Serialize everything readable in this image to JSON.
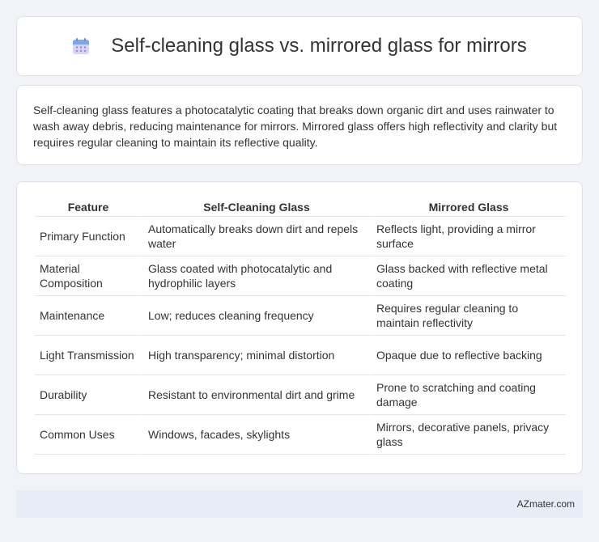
{
  "header": {
    "title": "Self-cleaning glass vs. mirrored glass for mirrors",
    "icon": "calendar-icon"
  },
  "intro": {
    "text": "Self-cleaning glass features a photocatalytic coating that breaks down organic dirt and uses rainwater to wash away debris, reducing maintenance for mirrors. Mirrored glass offers high reflectivity and clarity but requires regular cleaning to maintain its reflective quality."
  },
  "table": {
    "headers": [
      "Feature",
      "Self-Cleaning Glass",
      "Mirrored Glass"
    ],
    "rows": [
      [
        "Primary Function",
        "Automatically breaks down dirt and repels water",
        "Reflects light, providing a mirror surface"
      ],
      [
        "Material Composition",
        "Glass coated with photocatalytic and hydrophilic layers",
        "Glass backed with reflective metal coating"
      ],
      [
        "Maintenance",
        "Low; reduces cleaning frequency",
        "Requires regular cleaning to maintain reflectivity"
      ],
      [
        "Light Transmission",
        "High transparency; minimal distortion",
        "Opaque due to reflective backing"
      ],
      [
        "Durability",
        "Resistant to environmental dirt and grime",
        "Prone to scratching and coating damage"
      ],
      [
        "Common Uses",
        "Windows, facades, skylights",
        "Mirrors, decorative panels, privacy glass"
      ]
    ]
  },
  "footer": {
    "text": "AZmater.com"
  }
}
